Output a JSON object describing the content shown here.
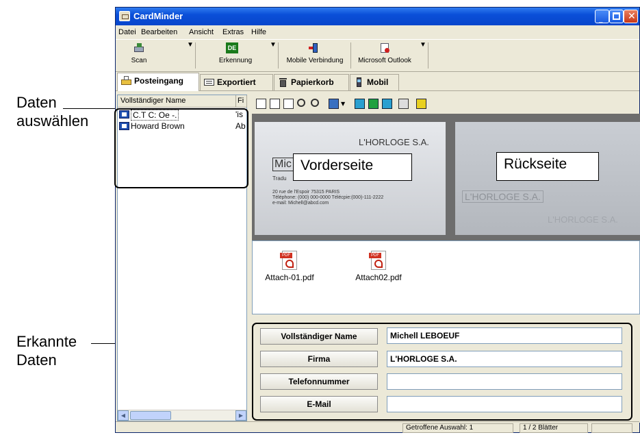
{
  "window": {
    "title": "CardMinder"
  },
  "menu": [
    "Datei",
    "Bearbeiten",
    "Ansicht",
    "Extras",
    "Hilfe"
  ],
  "toolbar": {
    "scan": "Scan",
    "recognize": "Erkennung",
    "mobile": "Mobile Verbindung",
    "outlook": "Microsoft Outlook",
    "recognize_icon_text": "DE"
  },
  "tabs": [
    "Posteingang",
    "Exportiert",
    "Papierkorb",
    "Mobil"
  ],
  "list": {
    "headers": [
      "Vollständiger Name",
      "Fi"
    ],
    "rows": [
      {
        "name": "C.T C: Oe -.",
        "firm": "'is"
      },
      {
        "name": "Howard Brown",
        "firm": "Ab"
      }
    ]
  },
  "card_front": {
    "company": "L'HORLOGE S.A.",
    "name_partial": "Mic",
    "title_partial": "Tradu",
    "address": "20 rue de l'Espoir 75315 PARIS",
    "phone": "Téléphone: (000) 000-0000   Télécpie:(000)-111-2222",
    "email": "e-mail: Michell@abcd.com"
  },
  "card_back": {
    "text1": "L'HORLOGE S.A.",
    "text2": "L'HORLOGE S.A."
  },
  "labels": {
    "front": "Vorderseite",
    "back": "Rückseite"
  },
  "attachments": [
    {
      "name": "Attach-01.pdf",
      "tag": "PDF"
    },
    {
      "name": "Attach02.pdf",
      "tag": "PDF"
    }
  ],
  "fields": [
    {
      "label": "Vollständiger Name",
      "value": "Michell LEBOEUF"
    },
    {
      "label": "Firma",
      "value": "L'HORLOGE S.A."
    },
    {
      "label": "Telefonnummer",
      "value": ""
    },
    {
      "label": "E-Mail",
      "value": ""
    }
  ],
  "status": {
    "selection": "Getroffene Auswahl:  1",
    "page": "1 /   2 Blätter"
  },
  "annotations": {
    "select_line1": "Daten",
    "select_line2": "auswählen",
    "recognized_line1": "Erkannte",
    "recognized_line2": "Daten"
  },
  "colors": {
    "titlebar": "#0a4fd8",
    "card_bg": "#d8dadf",
    "image_bg": "#6d6d6d"
  }
}
